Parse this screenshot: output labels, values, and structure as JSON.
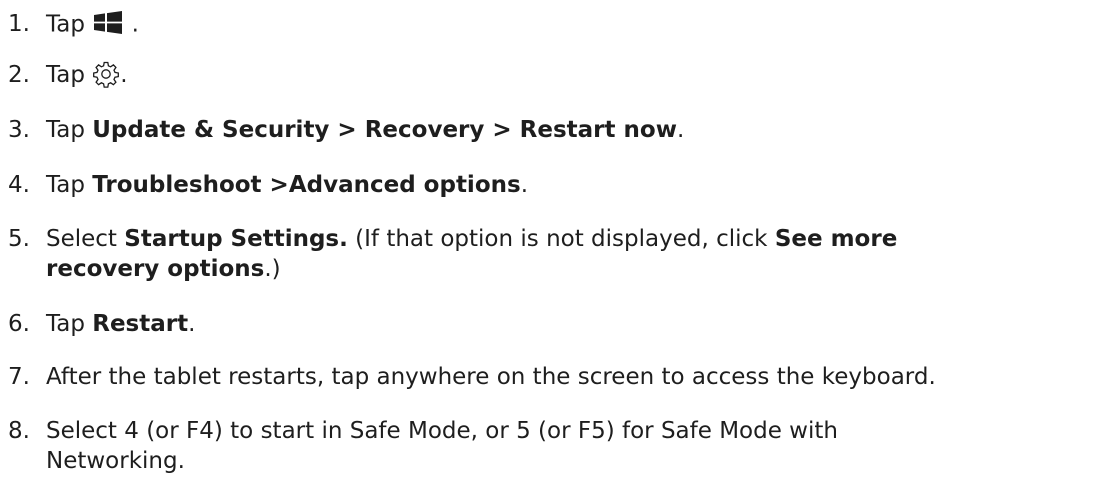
{
  "steps": [
    {
      "num": "1.",
      "tap": "Tap",
      "icon": "windows-start-icon",
      "after": "."
    },
    {
      "num": "2.",
      "tap": "Tap",
      "icon": "gear-icon",
      "after": "."
    },
    {
      "num": "3.",
      "tap": "Tap",
      "bold": "Update & Security > Recovery > Restart now",
      "after": "."
    },
    {
      "num": "4.",
      "tap": "Tap",
      "bold": "Troubleshoot >Advanced options",
      "after": "."
    },
    {
      "num": "5.",
      "pre": "Select",
      "bold1": "Startup Settings.",
      "mid": "(If that option is not displayed, click",
      "bold2": "See more",
      "bold3": "recovery options",
      "after": ".)"
    },
    {
      "num": "6.",
      "tap": "Tap",
      "bold": "Restart",
      "after": "."
    },
    {
      "num": "7.",
      "text": "After the tablet restarts, tap anywhere on the screen to access the keyboard."
    },
    {
      "num": "8.",
      "line1": "Select 4 (or F4) to start in Safe Mode, or 5 (or F5) for Safe Mode with",
      "line2": "Networking."
    }
  ]
}
